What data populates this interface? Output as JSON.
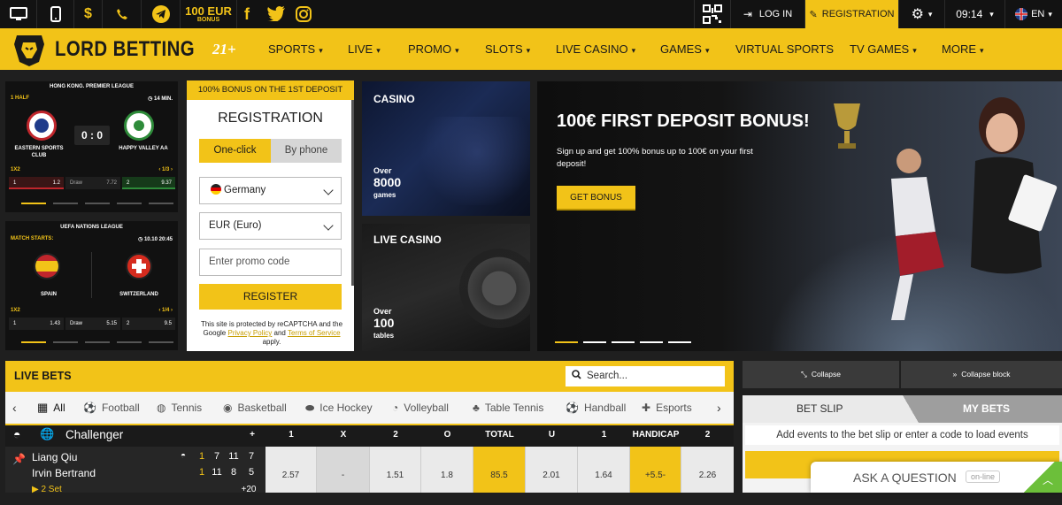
{
  "topbar": {
    "bonus_amount": "100 EUR",
    "bonus_label": "BONUS",
    "login": "LOG IN",
    "registration": "REGISTRATION",
    "time": "09:14",
    "lang": "EN"
  },
  "nav": {
    "logo_text": "LORD BETTING",
    "age": "21+",
    "items": [
      "SPORTS",
      "LIVE",
      "PROMO",
      "SLOTS",
      "LIVE CASINO",
      "GAMES",
      "VIRTUAL SPORTS",
      "TV GAMES",
      "MORE"
    ]
  },
  "match1": {
    "league": "HONG KONG. PREMIER LEAGUE",
    "period": "1 HALF",
    "minute": "14 MIN.",
    "team1": "EASTERN SPORTS CLUB",
    "team2": "HAPPY VALLEY AA",
    "score": "0 : 0",
    "market": "1X2",
    "page": "1/3",
    "odds": [
      "1",
      "1.2",
      "Draw",
      "7.72",
      "2",
      "9.37"
    ]
  },
  "match2": {
    "league": "UEFA NATIONS LEAGUE",
    "starts_label": "MATCH STARTS:",
    "start": "10.10 20:45",
    "team1": "SPAIN",
    "team2": "SWITZERLAND",
    "market": "1X2",
    "page": "1/4",
    "odds": [
      "1",
      "1.43",
      "Draw",
      "5.15",
      "2",
      "9.5"
    ]
  },
  "registration": {
    "banner": "100% BONUS ON THE 1ST DEPOSIT",
    "title": "REGISTRATION",
    "tab_oneclick": "One-click",
    "tab_phone": "By phone",
    "country": "Germany",
    "currency": "EUR (Euro)",
    "promo_placeholder": "Enter promo code",
    "button": "REGISTER",
    "legal_1": "This site is protected by reCAPTCHA and the Google",
    "privacy": "Privacy Policy",
    "and": "and",
    "terms": "Terms of Service",
    "applies": "apply."
  },
  "casino": {
    "title": "CASINO",
    "over": "Over",
    "count": "8000",
    "unit": "games"
  },
  "live_casino": {
    "title": "LIVE CASINO",
    "over": "Over",
    "count": "100",
    "unit": "tables"
  },
  "promo": {
    "title": "100€ FIRST DEPOSIT BONUS!",
    "text": "Sign up and get 100% bonus up to 100€ on your first deposit!",
    "button": "GET BONUS"
  },
  "live_bets": {
    "title": "LIVE BETS",
    "search_placeholder": "Search...",
    "categories": [
      "All",
      "Football",
      "Tennis",
      "Basketball",
      "Ice Hockey",
      "Volleyball",
      "Table Tennis",
      "Handball",
      "Esports"
    ],
    "league": "Challenger",
    "columns": [
      "+",
      "1",
      "X",
      "2",
      "O",
      "TOTAL",
      "U",
      "1",
      "HANDICAP",
      "2"
    ],
    "player1": "Liang Qiu",
    "player2": "Irvin Bertrand",
    "sets_p1": [
      "1",
      "7",
      "11",
      "7"
    ],
    "sets_p2": [
      "1",
      "11",
      "8",
      "5"
    ],
    "set_label": "2 Set",
    "plus_count": "+20",
    "odds": [
      "2.57",
      "-",
      "1.51",
      "1.8",
      "85.5",
      "2.01",
      "1.64",
      "+5.5-",
      "2.26"
    ]
  },
  "slip": {
    "collapse": "Collapse",
    "collapse_block": "Collapse block",
    "tab_betslip": "BET SLIP",
    "tab_mybets": "MY BETS",
    "empty_text": "Add events to the bet slip or enter a code to load events",
    "ask": "ASK A QUESTION",
    "online": "on-line"
  },
  "colors": {
    "accent": "#f2c318",
    "dark": "#0d0d0d",
    "red": "#c0262c",
    "green": "#2e8b3a"
  }
}
